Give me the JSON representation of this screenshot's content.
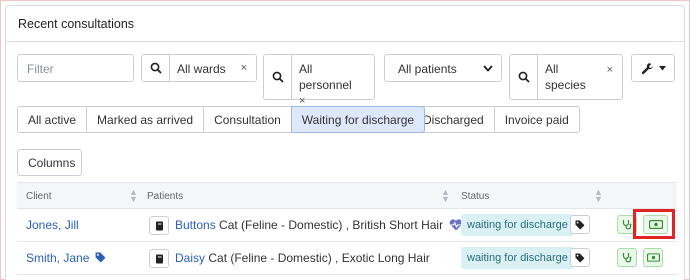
{
  "panel": {
    "title": "Recent consultations"
  },
  "filters": {
    "filter_placeholder": "Filter",
    "wards": {
      "label": "All wards",
      "clear": "×"
    },
    "personnel": {
      "label": "All personnel",
      "clear": "×"
    },
    "patients": {
      "selected": "All patients"
    },
    "species": {
      "label": "All species",
      "clear": "×"
    },
    "tool_icon": "wrench-icon"
  },
  "tabs": [
    {
      "label": "All active"
    },
    {
      "label": "Marked as arrived"
    },
    {
      "label": "Consultation"
    },
    {
      "label": "Waiting for discharge",
      "active": true
    }
  ],
  "tabs2": [
    {
      "label": "Discharged"
    },
    {
      "label": "Invoice paid"
    }
  ],
  "columns_button": "Columns",
  "table": {
    "headers": {
      "client": "Client",
      "patients": "Patients",
      "status": "Status"
    },
    "rows": [
      {
        "client": "Jones, Jill",
        "patient_name": "Buttons",
        "patient_desc": " Cat (Feline - Domestic) , British Short Hair",
        "status": "waiting for discharge",
        "has_heart_icon": true,
        "client_tag": false
      },
      {
        "client": "Smith, Jane",
        "patient_name": "Daisy",
        "patient_desc": " Cat (Feline - Domestic) , Exotic Long Hair",
        "status": "waiting for discharge",
        "has_heart_icon": false,
        "client_tag": true
      }
    ]
  },
  "colors": {
    "link": "#2b5fb8",
    "status_bg": "#d9f1f4",
    "status_text": "#2a6f78",
    "active_tab": "#dde9fb",
    "highlight": "#e02424",
    "action_green": "#e9f8e9"
  }
}
